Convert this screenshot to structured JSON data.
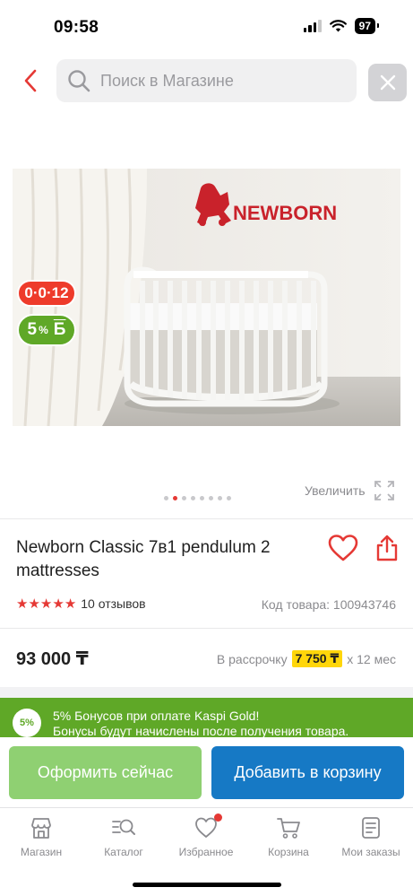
{
  "status_bar": {
    "time": "09:58",
    "battery": "97"
  },
  "search": {
    "placeholder": "Поиск в Магазине",
    "value": ""
  },
  "product": {
    "badge_installment": "0·0·12",
    "badge_bonus_value": "5",
    "badge_bonus_suffix": "%",
    "badge_bonus_currency": "Б",
    "image_logo_text": "NEWBORN",
    "carousel": {
      "total": 8,
      "active_index": 1
    },
    "zoom_label": "Увеличить",
    "title": "Newborn Classic 7в1 pendulum 2 mattresses",
    "rating": 5,
    "reviews_label": "10 отзывов",
    "code_label": "Код товара: 100943746",
    "price": "93 000 ₸",
    "installment_prefix": "В рассрочку",
    "installment_amount": "7 750 ₸",
    "installment_suffix": "х 12 мес"
  },
  "bonus_banner": {
    "circle": "5%",
    "line1": "5% Бонусов при оплате Kaspi Gold!",
    "line2": "Бонусы будут начислены после получения товара."
  },
  "actions": {
    "buy_now": "Оформить сейчас",
    "add_to_cart": "Добавить в корзину"
  },
  "tabs": [
    {
      "label": "Магазин",
      "icon": "store-icon"
    },
    {
      "label": "Каталог",
      "icon": "catalog-search-icon"
    },
    {
      "label": "Избранное",
      "icon": "heart-icon",
      "has_notification": true
    },
    {
      "label": "Корзина",
      "icon": "cart-icon"
    },
    {
      "label": "Мои заказы",
      "icon": "orders-icon"
    }
  ],
  "colors": {
    "accent_red": "#e53935",
    "bonus_green": "#5fa827",
    "buy_green": "#8fd072",
    "cart_blue": "#1679c5",
    "installment_yellow": "#ffd60a"
  }
}
